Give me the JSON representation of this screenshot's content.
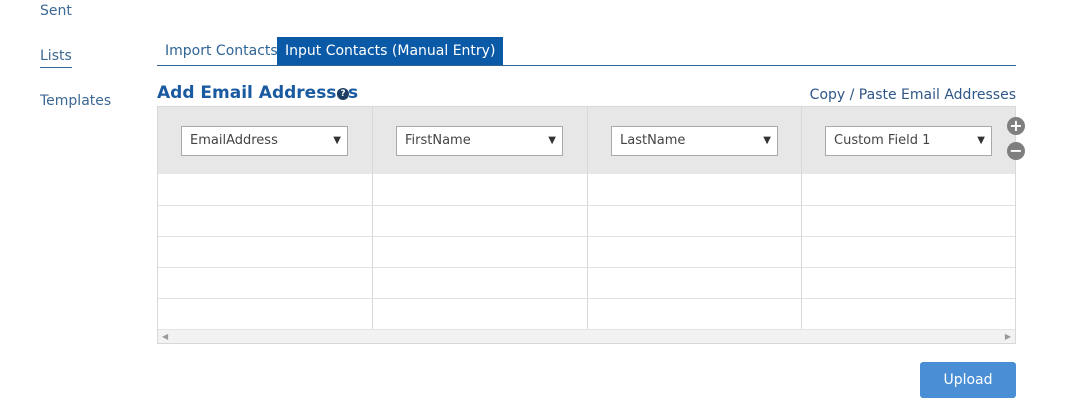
{
  "sidebar": {
    "items": [
      {
        "label": "Sent"
      },
      {
        "label": "Lists"
      },
      {
        "label": "Templates"
      }
    ]
  },
  "tabs": [
    {
      "label": "Import Contacts"
    },
    {
      "label": "Input Contacts (Manual Entry)"
    }
  ],
  "section": {
    "title": "Add Email Addresses",
    "help_glyph": "?",
    "copy_paste_link": "Copy / Paste Email Addresses"
  },
  "grid": {
    "columns": [
      {
        "selected": "EmailAddress"
      },
      {
        "selected": "FirstName"
      },
      {
        "selected": "LastName"
      },
      {
        "selected": "Custom Field 1"
      }
    ],
    "add_column_glyph": "+",
    "remove_column_glyph": "−"
  },
  "actions": {
    "upload_label": "Upload"
  }
}
